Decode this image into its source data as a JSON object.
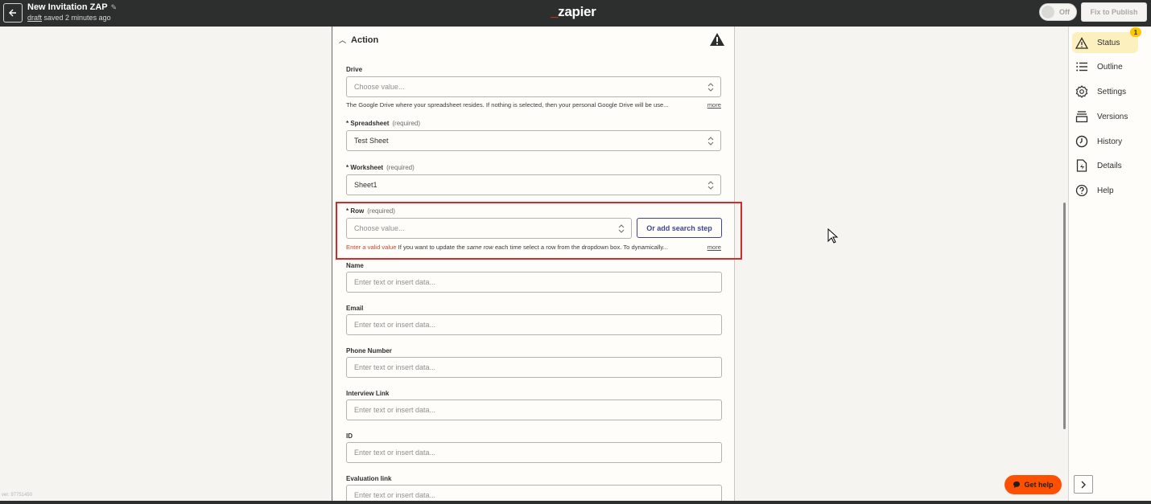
{
  "header": {
    "zap_title": "New Invitation ZAP",
    "status_link": "draft",
    "saved_text": "saved 2 minutes ago",
    "logo_prefix": "_",
    "logo_text": "zapier",
    "toggle_label": "Off",
    "publish_button": "Fix to Publish"
  },
  "action": {
    "section_title": "Action",
    "fields": {
      "drive": {
        "label": "Drive",
        "placeholder": "Choose value...",
        "help": "The Google Drive where your spreadsheet resides. If nothing is selected, then your personal Google Drive will be use...",
        "more": "more"
      },
      "spreadsheet": {
        "label": "* Spreadsheet",
        "required": "(required)",
        "value": "Test Sheet"
      },
      "worksheet": {
        "label": "* Worksheet",
        "required": "(required)",
        "value": "Sheet1"
      },
      "row": {
        "label": "* Row",
        "required": "(required)",
        "placeholder": "Choose value...",
        "search_step_button": "Or add search step",
        "error": "Enter a valid value",
        "help_pre": "If you want to update the",
        "help_em": "same row",
        "help_post": "each time select a row from the dropdown box. To dynamically...",
        "more": "more"
      },
      "text_fields": [
        {
          "label": "Name",
          "placeholder": "Enter text or insert data..."
        },
        {
          "label": "Email",
          "placeholder": "Enter text or insert data..."
        },
        {
          "label": "Phone Number",
          "placeholder": "Enter text or insert data..."
        },
        {
          "label": "Interview Link",
          "placeholder": "Enter text or insert data..."
        },
        {
          "label": "ID",
          "placeholder": "Enter text or insert data..."
        },
        {
          "label": "Evaluation link",
          "placeholder": "Enter text or insert data..."
        }
      ]
    }
  },
  "sidebar": {
    "items": [
      {
        "label": "Status",
        "badge": "1"
      },
      {
        "label": "Outline"
      },
      {
        "label": "Settings"
      },
      {
        "label": "Versions"
      },
      {
        "label": "History"
      },
      {
        "label": "Details"
      },
      {
        "label": "Help"
      }
    ]
  },
  "footer": {
    "get_help": "Get help",
    "version": "ver. 97751450"
  },
  "colors": {
    "brand_orange": "#ff4f00",
    "error_red": "#d4442c",
    "status_highlight": "#fdf0bf",
    "badge_yellow": "#ffc700",
    "button_blue": "#3d4592"
  }
}
